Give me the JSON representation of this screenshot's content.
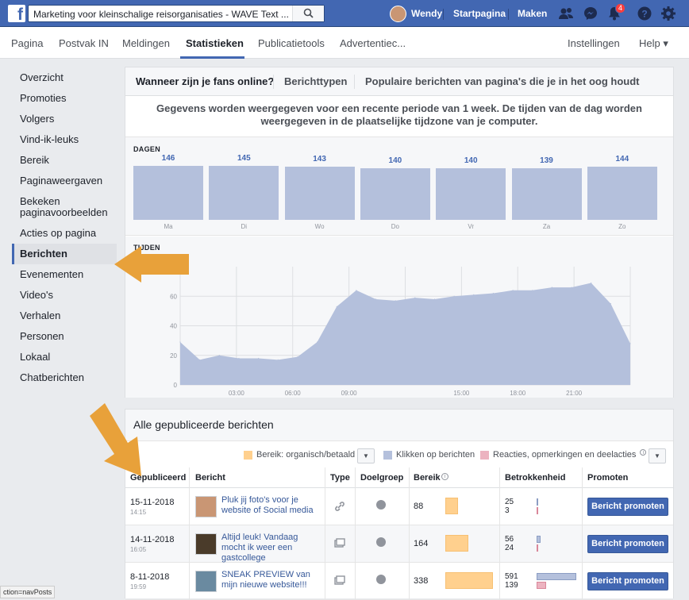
{
  "topbar": {
    "logo": "f",
    "search_text": "Marketing voor kleinschalige reisorganisaties - WAVE Text ...",
    "user_name": "Wendy",
    "home": "Startpagina",
    "create": "Maken",
    "notif_count": "4"
  },
  "pagenav": {
    "items": [
      "Pagina",
      "Postvak IN",
      "Meldingen",
      "Statistieken",
      "Publicatietools",
      "Advertentiec..."
    ],
    "settings": "Instellingen",
    "help": "Help ▾"
  },
  "sidebar": {
    "items": [
      "Overzicht",
      "Promoties",
      "Volgers",
      "Vind-ik-leuks",
      "Bereik",
      "Paginaweergaven",
      "Bekeken paginavoorbeelden",
      "Acties op pagina",
      "Berichten",
      "Evenementen",
      "Video's",
      "Verhalen",
      "Personen",
      "Lokaal",
      "Chatberichten"
    ]
  },
  "tabs": {
    "t1": "Wanneer zijn je fans online?",
    "t2": "Berichttypen",
    "t3": "Populaire berichten van pagina's die je in het oog houdt"
  },
  "notice": "Gegevens worden weergegeven voor een recente periode van 1 week. De tijden van de dag worden weergegeven in de plaatselijke tijdzone van je computer.",
  "chart_data": [
    {
      "type": "bar",
      "title": "DAGEN",
      "categories": [
        "Ma",
        "Di",
        "Wo",
        "Do",
        "Vr",
        "Za",
        "Zo"
      ],
      "values": [
        146,
        145,
        143,
        140,
        140,
        139,
        144
      ]
    },
    {
      "type": "area",
      "title": "TIJDEN",
      "x": [
        0,
        1,
        2,
        3,
        4,
        5,
        6,
        7,
        8,
        9,
        10,
        11,
        12,
        13,
        14,
        15,
        16,
        17,
        18,
        19,
        20,
        21,
        22,
        23
      ],
      "values": [
        29,
        17,
        20,
        18,
        18,
        17,
        19,
        29,
        53,
        64,
        58,
        57,
        59,
        58,
        60,
        61,
        62,
        64,
        64,
        66,
        66,
        69,
        55,
        28
      ],
      "yticks": [
        0,
        20,
        40,
        60
      ],
      "xticks": [
        "03:00",
        "06:00",
        "09:00",
        "15:00",
        "18:00",
        "21:00"
      ],
      "ylim": [
        0,
        80
      ]
    }
  ],
  "posts": {
    "title": "Alle gepubliceerde berichten",
    "legend": [
      "Bereik: organisch/betaald",
      "Klikken op berichten",
      "Reacties, opmerkingen en deelacties"
    ],
    "legend_colors": [
      "#ffd08e",
      "#b4c0dc",
      "#ecb3c0"
    ],
    "info_icon": "i",
    "dropdown_icon": "▼",
    "columns": [
      "Gepubliceerd",
      "Bericht",
      "Type",
      "Doelgroep",
      "Bereik",
      "Betrokkenheid",
      "Promoten"
    ],
    "rows": [
      {
        "date": "15-11-2018",
        "time": "14:15",
        "text": "Pluk jij foto's voor je website of Social media",
        "reach": "88",
        "reach_value": 88,
        "eng1": "25",
        "eng2": "3",
        "clicks": 25,
        "reactions": 3,
        "type_icon": "link-icon",
        "promote": "Bericht promoten"
      },
      {
        "date": "14-11-2018",
        "time": "16:05",
        "text": "Altijd leuk! Vandaag mocht ik weer een gastcollege",
        "reach": "164",
        "reach_value": 164,
        "eng1": "56",
        "eng2": "24",
        "clicks": 56,
        "reactions": 24,
        "type_icon": "photo-icon",
        "promote": "Bericht promoten"
      },
      {
        "date": "8-11-2018",
        "time": "19:59",
        "text": "SNEAK PREVIEW van mijn nieuwe website!!!",
        "reach": "338",
        "reach_value": 338,
        "eng1": "591",
        "eng2": "139",
        "clicks": 591,
        "reactions": 139,
        "type_icon": "photo-icon",
        "promote": "Bericht promoten"
      }
    ]
  },
  "statusbar": "ction=navPosts"
}
